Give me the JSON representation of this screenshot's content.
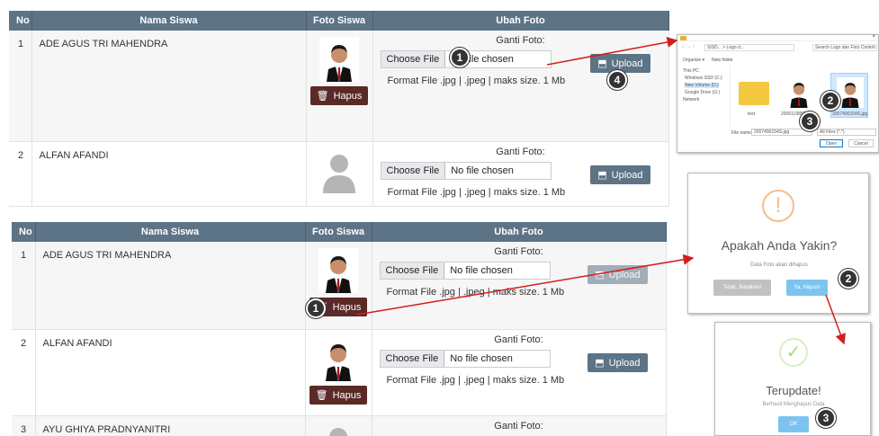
{
  "table1": {
    "headers": [
      "No",
      "Nama Siswa",
      "Foto Siswa",
      "Ubah Foto"
    ],
    "rows": [
      {
        "no": "1",
        "name": "ADE AGUS TRI MAHENDRA",
        "file": "No file chosen",
        "has_photo": true
      },
      {
        "no": "2",
        "name": "ALFAN AFANDI",
        "file": "No file chosen",
        "has_photo": false
      }
    ]
  },
  "table2": {
    "headers": [
      "No",
      "Nama Siswa",
      "Foto Siswa",
      "Ubah Foto"
    ],
    "rows": [
      {
        "no": "1",
        "name": "ADE AGUS TRI MAHENDRA",
        "file": "No file chosen",
        "has_photo": true
      },
      {
        "no": "2",
        "name": "ALFAN AFANDI",
        "file": "No file chosen",
        "has_photo": true
      },
      {
        "no": "3",
        "name": "AYU GHIYA PRADNYANITRI",
        "file": "",
        "has_photo": false
      }
    ]
  },
  "common": {
    "ganti_foto": "Ganti Foto:",
    "choose_file": "Choose File",
    "format_note": "Format File .jpg | .jpeg | maks size. 1 Mb",
    "upload": "Upload",
    "hapus": "Hapus"
  },
  "file_dialog": {
    "breadcrumb": "SISD... > Logo d...",
    "search": "Search Logo dan Foto Contoh",
    "organize": "Organize ▾",
    "new_folder": "New folder",
    "nav": [
      "This PC",
      "Windows SSD (C:)",
      "New Volume (D:)",
      "Google Drive (G:)",
      "Network"
    ],
    "files": [
      "test",
      "20061198559.jpg",
      "2007490154S.jpg"
    ],
    "file_name_label": "File name:",
    "file_name_value": "2007490154S.jpg",
    "filter": "All Files (*.*)",
    "open": "Open",
    "cancel": "Cancel"
  },
  "confirm_dialog": {
    "title": "Apakah Anda Yakin?",
    "text": "Data Foto akan dihapus",
    "cancel": "Tidak, Batalkan!",
    "confirm": "Ya, Hapus!"
  },
  "success_dialog": {
    "title": "Terupdate!",
    "text": "Berhasil Menghapus Data",
    "ok": "OK"
  },
  "badges": [
    "1",
    "2",
    "3",
    "4"
  ],
  "colors": {
    "header": "#5d7386",
    "hapus": "#5a2a27",
    "arrow": "#d11f1f",
    "sweet_blue": "#7cc4ef",
    "sweet_green": "#a5dc86",
    "sweet_warn": "#f8bb86"
  }
}
